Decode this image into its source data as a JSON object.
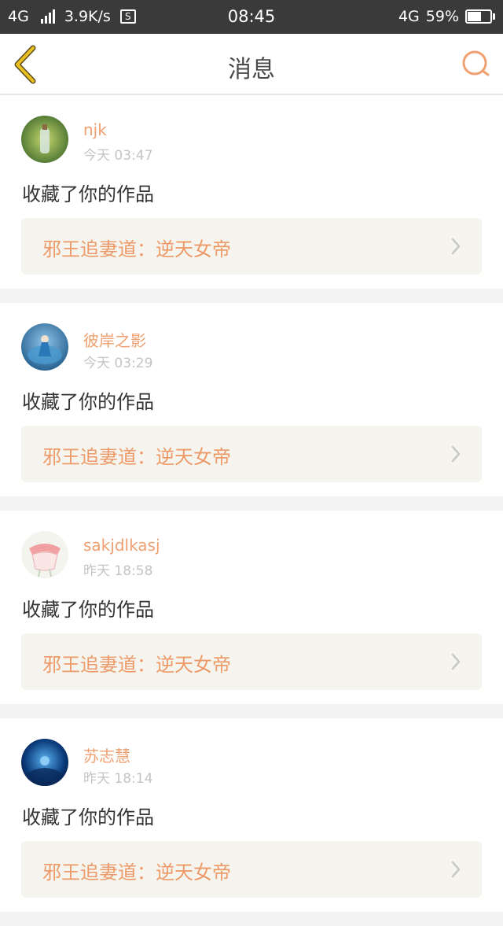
{
  "status_bar": {
    "network_left": "4G",
    "speed": "3.9K/s",
    "sim_label": "S",
    "time": "08:45",
    "network_right": "4G",
    "battery_percent": "59%",
    "battery_level": 0.59
  },
  "header": {
    "title": "消息",
    "back_icon": "chevron-left-icon",
    "search_icon": "search-icon",
    "accent_color": "#f0a070",
    "back_color": "#e8c020"
  },
  "messages": [
    {
      "user": "njk",
      "time": "今天 03:47",
      "action": "收藏了你的作品",
      "work_title": "邪王追妻道：逆天女帝",
      "avatar_theme": "green-bottle"
    },
    {
      "user": "彼岸之影",
      "time": "今天 03:29",
      "action": "收藏了你的作品",
      "work_title": "邪王追妻道：逆天女帝",
      "avatar_theme": "blue-dancer"
    },
    {
      "user": "sakjdlkasj",
      "time": "昨天 18:58",
      "action": "收藏了你的作品",
      "work_title": "邪王追妻道：逆天女帝",
      "avatar_theme": "pink-dress"
    },
    {
      "user": "苏志慧",
      "time": "昨天 18:14",
      "action": "收藏了你的作品",
      "work_title": "邪王追妻道：逆天女帝",
      "avatar_theme": "blue-cave"
    }
  ]
}
